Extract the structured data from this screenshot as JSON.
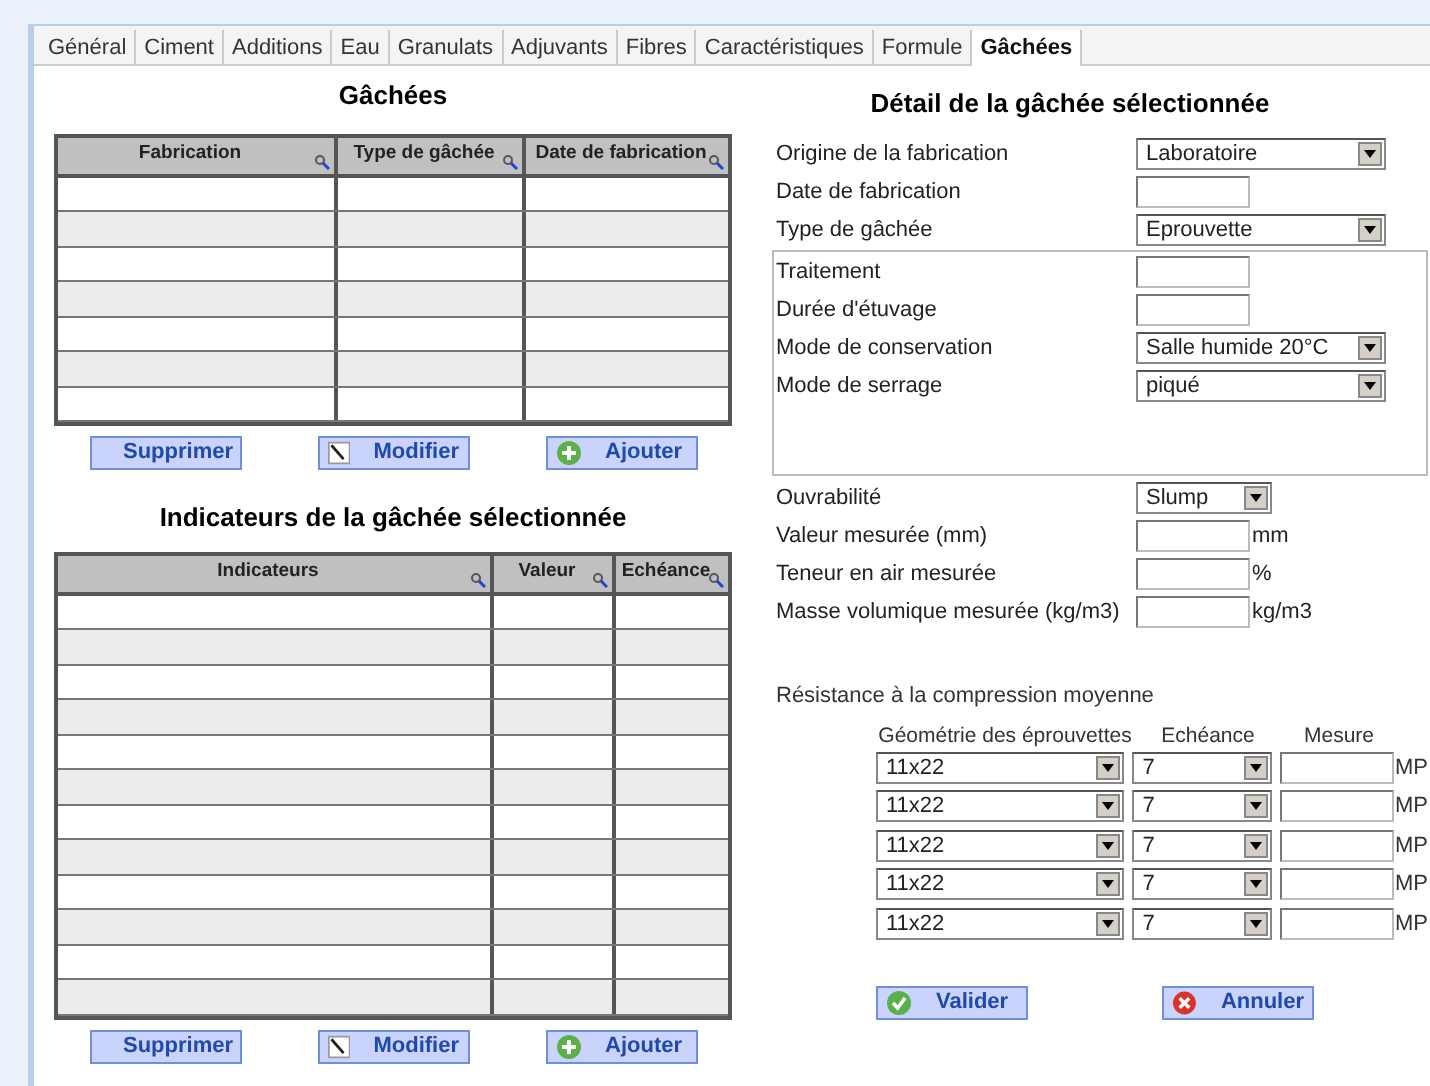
{
  "tabs": [
    {
      "label": "Général",
      "selected": false
    },
    {
      "label": "Ciment",
      "selected": false
    },
    {
      "label": "Additions",
      "selected": false
    },
    {
      "label": "Eau",
      "selected": false
    },
    {
      "label": "Granulats",
      "selected": false
    },
    {
      "label": "Adjuvants",
      "selected": false
    },
    {
      "label": "Fibres",
      "selected": false
    },
    {
      "label": "Caractéristiques",
      "selected": false
    },
    {
      "label": "Formule",
      "selected": false
    },
    {
      "label": "Gâchées",
      "selected": true
    }
  ],
  "batches": {
    "title": "Gâchées",
    "columns": [
      "Fabrication",
      "Type de gâchée",
      "Date de fabrication"
    ],
    "buttons": [
      {
        "kind": "delete",
        "label": "Supprimer"
      },
      {
        "kind": "edit",
        "label": "Modifier"
      },
      {
        "kind": "add",
        "label": "Ajouter"
      }
    ]
  },
  "indicators": {
    "title": "Indicateurs de la gâchée sélectionnée",
    "columns": [
      "Indicateurs",
      "Valeur",
      "Echéance"
    ],
    "buttons": [
      {
        "kind": "delete",
        "label": "Supprimer"
      },
      {
        "kind": "edit",
        "label": "Modifier"
      },
      {
        "kind": "add",
        "label": "Ajouter"
      }
    ]
  },
  "detail": {
    "title": "Détail de la gâchée sélectionnée",
    "fields": [
      {
        "kind": "select",
        "label": "Origine de la fabrication",
        "value": "Laboratoire"
      },
      {
        "kind": "input",
        "label": "Date de fabrication"
      },
      {
        "kind": "select",
        "label": "Type de gâchée",
        "value": "Eprouvette"
      }
    ],
    "group_fields": [
      {
        "kind": "input",
        "label": "Traitement"
      },
      {
        "kind": "input",
        "label": "Durée d'étuvage"
      },
      {
        "kind": "select",
        "label": "Mode de conservation",
        "value": "Salle humide 20°C"
      },
      {
        "kind": "select",
        "label": "Mode de serrage",
        "value": "piqué"
      }
    ],
    "bottom_fields": [
      {
        "kind": "small-select",
        "label": "Ouvrabilité",
        "value": "Slump"
      },
      {
        "kind": "input",
        "label": "Valeur mesurée (mm)",
        "unit": "mm"
      },
      {
        "kind": "input",
        "label": "Teneur en air mesurée",
        "unit": "%"
      },
      {
        "kind": "input",
        "label": "Masse volumique mesurée (kg/m3)",
        "unit": "kg/m3"
      }
    ]
  },
  "compression": {
    "title": "Résistance à la compression moyenne",
    "columns": [
      "Géométrie des éprouvettes",
      "Echéance",
      "Mesure"
    ],
    "rows": [
      {
        "geometry": "11x22",
        "echeance": "7",
        "unit": "MP"
      },
      {
        "geometry": "11x22",
        "echeance": "7",
        "unit": "MP"
      },
      {
        "geometry": "11x22",
        "echeance": "7",
        "unit": "MP"
      },
      {
        "geometry": "11x22",
        "echeance": "7",
        "unit": "MP"
      },
      {
        "geometry": "11x22",
        "echeance": "7",
        "unit": "MP"
      }
    ]
  },
  "actions": [
    {
      "kind": "validate",
      "label": "Valider"
    },
    {
      "kind": "cancel",
      "label": "Annuler"
    }
  ]
}
